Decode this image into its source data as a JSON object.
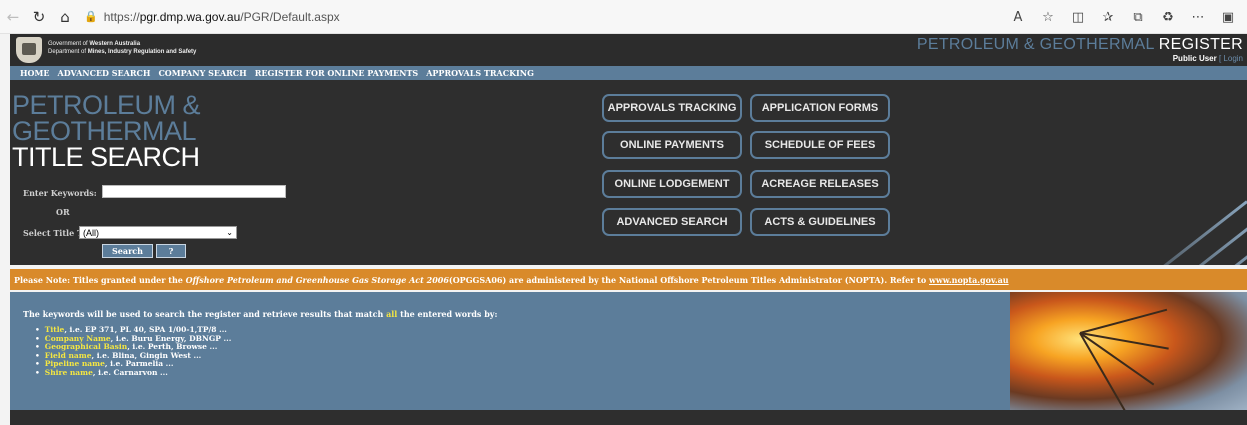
{
  "browser": {
    "url_prefix": "https://",
    "url_host": "pgr.dmp.wa.gov.au",
    "url_path": "/PGR/Default.aspx"
  },
  "header": {
    "gov_line1_prefix": "Government of ",
    "gov_line1_bold": "Western Australia",
    "gov_line2_prefix": "Department of ",
    "gov_line2_bold": "Mines, Industry Regulation and Safety",
    "brand_main": "PETROLEUM & GEOTHERMAL ",
    "brand_register": "REGISTER",
    "user": "Public User",
    "login": "[ Login"
  },
  "menu": {
    "items": [
      "HOME",
      "ADVANCED SEARCH",
      "COMPANY SEARCH",
      "REGISTER FOR ONLINE PAYMENTS",
      "APPROVALS TRACKING"
    ]
  },
  "hero": {
    "title_line1": "PETROLEUM &",
    "title_line2": "GEOTHERMAL",
    "title_line3": "TITLE SEARCH",
    "keywords_label": "Enter Keywords:",
    "keywords_value": "",
    "or_label": "OR",
    "type_label": "Select Title Type:",
    "type_selected": "(All)",
    "search_label": "Search",
    "help_label": "?",
    "tiles": [
      "APPROVALS TRACKING",
      "APPLICATION FORMS",
      "ONLINE PAYMENTS",
      "SCHEDULE OF FEES",
      "ONLINE LODGEMENT",
      "ACREAGE RELEASES",
      "ADVANCED SEARCH",
      "ACTS & GUIDELINES"
    ]
  },
  "notice": {
    "prefix": "Please Note: Titles granted under the ",
    "act": "Offshore Petroleum and Greenhouse Gas Storage Act 2006",
    "suffix": " (OPGGSA06) are administered by the National Offshore Petroleum Titles Administrator (NOPTA). Refer to ",
    "link": "www.nopta.gov.au"
  },
  "info": {
    "intro_prefix": "The keywords will be used to search the register and retrieve results that match ",
    "intro_highlight": "all",
    "intro_suffix": " the entered words by:",
    "items": [
      {
        "key": "Title",
        "rest": ", i.e. EP 371, PL 40, SPA 1/00-1,TP/8 ..."
      },
      {
        "key": "Company Name",
        "rest": ", i.e. Buru Energy, DBNGP ..."
      },
      {
        "key": "Geographical Basin",
        "rest": ", i.e. Perth, Browse ..."
      },
      {
        "key": "Field name",
        "rest": ", i.e. Blina, Gingin West ..."
      },
      {
        "key": "Pipeline name",
        "rest": ", i.e. Parmelia ..."
      },
      {
        "key": "Shire name",
        "rest": ", i.e. Carnarvon ..."
      }
    ]
  },
  "colors": {
    "accent_blue": "#5c7d9a",
    "dark_bg": "#2e2e2e",
    "notice_orange": "#d98a2a",
    "highlight_yellow": "#f4e642"
  },
  "icons": [
    "back-icon",
    "refresh-icon",
    "home-icon",
    "lock-icon",
    "read-aloud-icon",
    "favorite-icon",
    "split-screen-icon",
    "favorites-bar-icon",
    "collections-icon",
    "extension-icon",
    "more-icon",
    "sidebar-icon"
  ]
}
